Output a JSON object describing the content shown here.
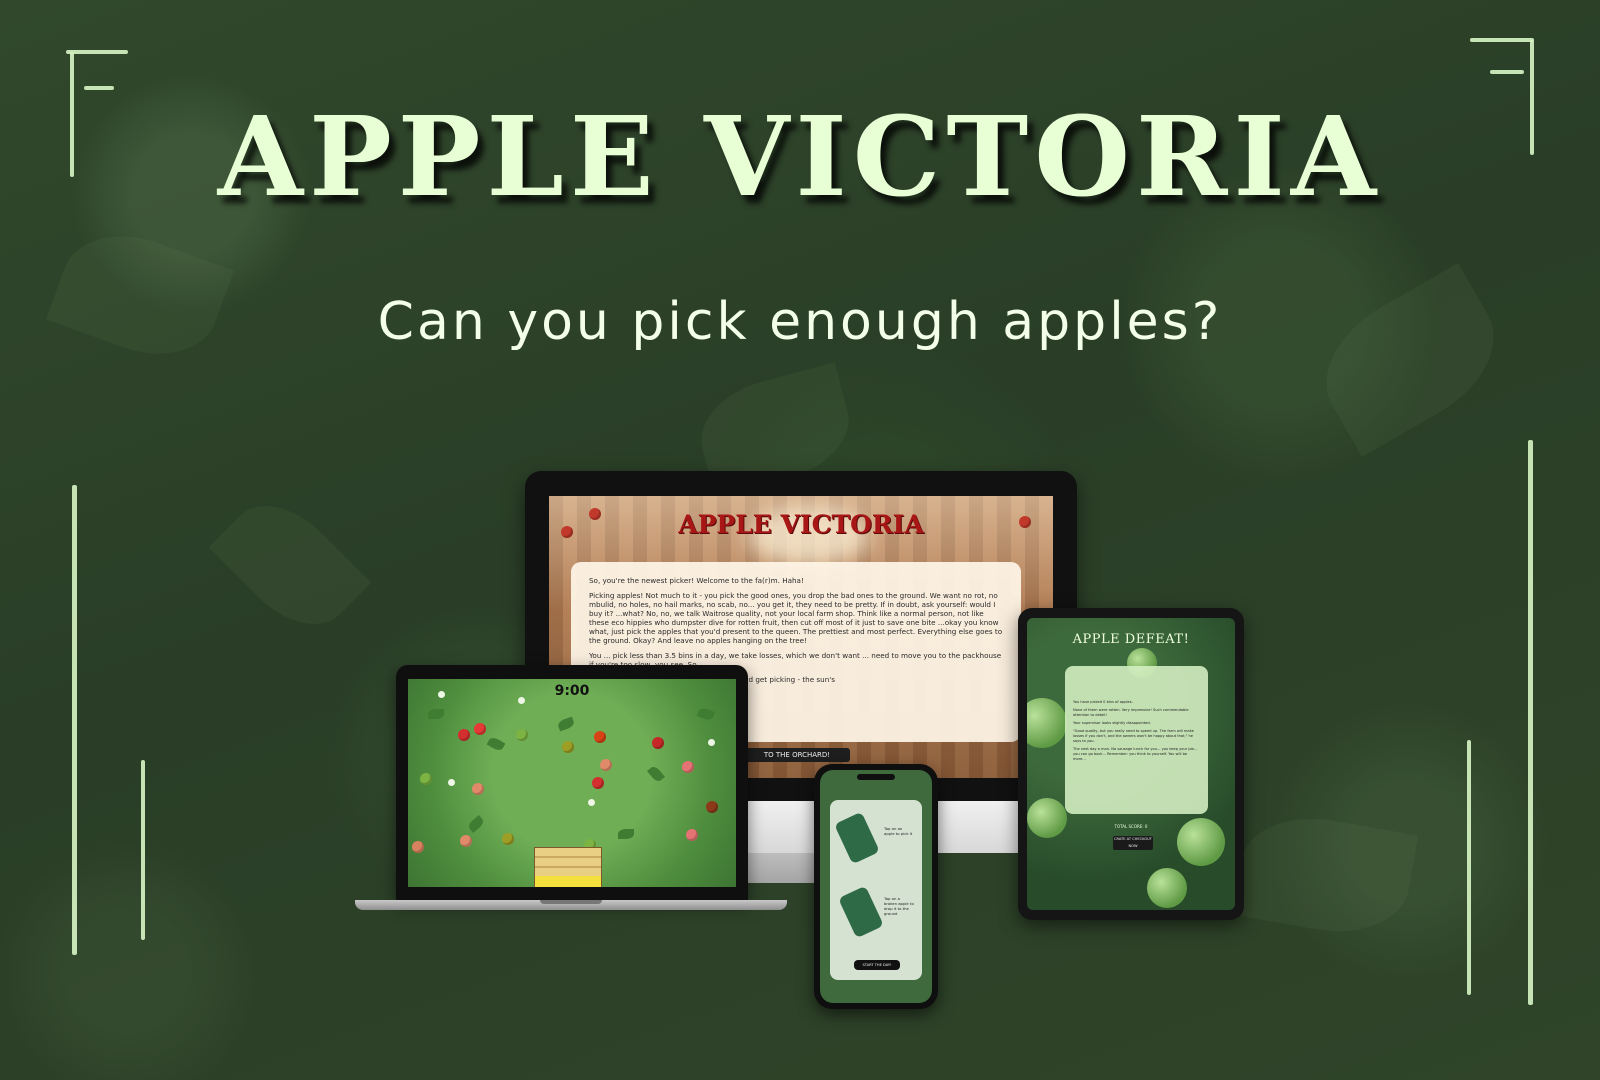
{
  "title": "APPLE VICTORIA",
  "subtitle": "Can you pick enough apples?",
  "colors": {
    "title": "#e8ffd6",
    "frame": "#d7f5c4",
    "accent_red": "#a81616"
  },
  "desktop": {
    "app_title": "APPLE VICTORIA",
    "paragraphs": [
      "So, you're the newest picker! Welcome to the fa(r)m. Haha!",
      "Picking apples! Not much to it - you pick the good ones, you drop the bad ones to the ground. We want no rot, no mbulid, no holes, no hail marks, no scab, no... you get it, they need to be pretty. If in doubt, ask yourself: would I buy it? ...what? No, no, we talk Waitrose quality, not your local farm shop. Think like a normal person, not like these eco hippies who dumpster dive for rotten fruit, then cut off most of it just to save one bite ...okay you know what, just pick the apples that you'd present to the queen. The prettiest and most perfect. Everything else goes to the ground. Okay? And leave no apples hanging on the tree!",
      "You ... pick less than 3.5 bins in a day, we take losses, which we don't want ... need to move you to the packhouse if you're too slow, you see. So",
      "...ow, move your sorry ass to the orchard and get picking - the sun's"
    ],
    "button": "TO THE ORCHARD!"
  },
  "laptop": {
    "timer": "9:00"
  },
  "tablet": {
    "title": "APPLE DEFEAT!",
    "paragraphs": [
      "You have picked 0 bins of apples.",
      "None of them were rotten. Very impressive! Such commendable attention to detail!",
      "Your supervisor looks slightly disappointed.",
      "\"Good quality, but you really need to speed up. The farm will make losses if you don't, and the owners won't be happy about that,\" he says to you.",
      "The next day a man. No sausage lunch for you... you keep your job... you can go back... Remember: you think to yourself. You will be more..."
    ],
    "score": "TOTAL SCORE: 0",
    "button": "CRATE AT CHECKOUT NOW"
  },
  "phone": {
    "instruction_1": "Tap on an apple to pick it",
    "instruction_2": "Tap on a broken apple to drop it to the ground",
    "button": "START THE DAY!"
  }
}
